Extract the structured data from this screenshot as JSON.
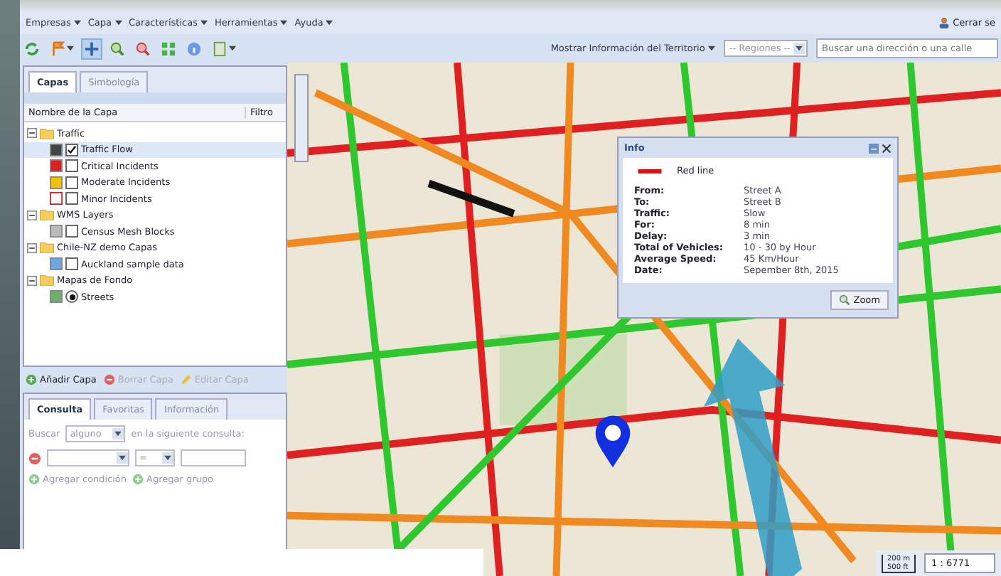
{
  "menu": [
    "Empresas",
    "Capa",
    "Características",
    "Herramientas",
    "Ayuda"
  ],
  "logout": "Cerrar se",
  "tools": [
    {
      "kind": "refresh",
      "selected": false,
      "dropdown": false
    },
    {
      "kind": "flag",
      "selected": false,
      "dropdown": true
    },
    {
      "kind": "pan",
      "selected": true,
      "dropdown": false
    },
    {
      "kind": "zoom-in",
      "selected": false,
      "dropdown": false
    },
    {
      "kind": "zoom-out",
      "selected": false,
      "dropdown": false
    },
    {
      "kind": "extent",
      "selected": false,
      "dropdown": false
    },
    {
      "kind": "info",
      "selected": false,
      "dropdown": false
    },
    {
      "kind": "export",
      "selected": false,
      "dropdown": true
    }
  ],
  "territory": "Mostrar Información del Territorio",
  "regions": "-- Regiones --",
  "search": {
    "placeholder": "Buscar una dirección o una calle"
  },
  "tabs": [
    {
      "label": "Capas",
      "selected": true
    },
    {
      "label": "Simbología",
      "selected": false
    }
  ],
  "columns": [
    "Nombre de la Capa",
    "Filtro"
  ],
  "layers": [
    {
      "label": "Traffic",
      "children": [
        {
          "label": "Traffic Flow",
          "kind": "checkbox",
          "checked": true,
          "selected": true
        },
        {
          "label": "Critical Incidents",
          "kind": "checkbox",
          "checked": false,
          "selected": false
        },
        {
          "label": "Moderate Incidents",
          "kind": "checkbox",
          "checked": false,
          "selected": false
        },
        {
          "label": "Minor Incidents",
          "kind": "checkbox",
          "checked": false,
          "selected": false
        }
      ]
    },
    {
      "label": "WMS Layers",
      "children": [
        {
          "label": "Census Mesh Blocks",
          "kind": "checkbox",
          "checked": false,
          "selected": false
        }
      ]
    },
    {
      "label": "Chile-NZ demo Capas",
      "children": [
        {
          "label": "Auckland sample data",
          "kind": "checkbox",
          "checked": false,
          "selected": false
        }
      ]
    },
    {
      "label": "Mapas de Fondo",
      "children": [
        {
          "label": "Streets",
          "kind": "radio",
          "checked": true,
          "selected": false
        }
      ]
    }
  ],
  "actions": [
    {
      "label": "Añadir Capa",
      "kind": "add",
      "disabled": false
    },
    {
      "label": "Borrar Capa",
      "kind": "remove",
      "disabled": true
    },
    {
      "label": "Editar Capa",
      "kind": "edit",
      "disabled": true
    }
  ],
  "query_tabs": [
    {
      "label": "Consulta",
      "selected": true
    },
    {
      "label": "Favoritas",
      "selected": false
    },
    {
      "label": "Información",
      "selected": false
    }
  ],
  "query": {
    "prefix": "Buscar",
    "match": "alguno",
    "suffix": "en la siguiente consulta:",
    "operator": "=",
    "add_condition": "Agregar condición",
    "add_group": "Agregar grupo"
  },
  "info": {
    "title": "Info",
    "legend": "Red line",
    "rows": [
      {
        "label": "From:",
        "value": "Street A"
      },
      {
        "label": "To:",
        "value": "Street B"
      },
      {
        "label": "Traffic:",
        "value": "Slow"
      },
      {
        "label": "For:",
        "value": "8 min"
      },
      {
        "label": "Delay:",
        "value": "3 min"
      },
      {
        "label": "Total of Vehicles:",
        "value": "10 - 30 by Hour"
      },
      {
        "label": "Average Speed:",
        "value": "45 Km/Hour"
      },
      {
        "label": "Date:",
        "value": "Sepember 8th, 2015"
      }
    ],
    "button": "Zoom"
  },
  "scale": {
    "metric": "200 m",
    "imperial": "500 ft",
    "ratio": "1 : 6771"
  }
}
